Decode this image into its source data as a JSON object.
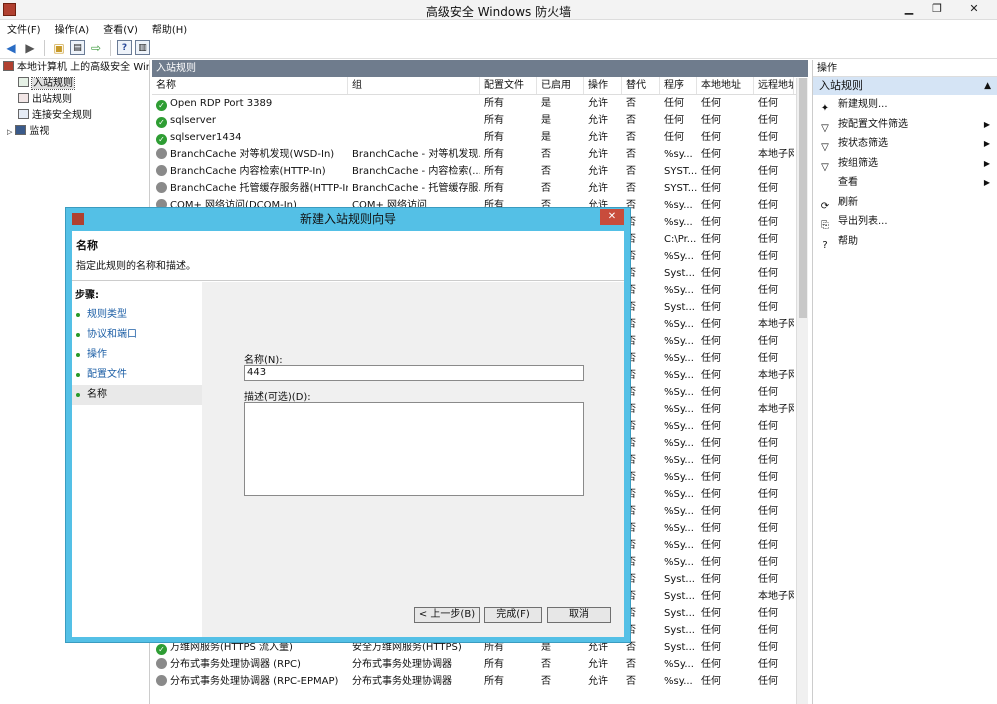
{
  "window": {
    "title": "高级安全 Windows 防火墙",
    "min": "▁",
    "max": "❐",
    "close": "✕"
  },
  "menu": [
    "文件(F)",
    "操作(A)",
    "查看(V)",
    "帮助(H)"
  ],
  "tree": [
    {
      "label": "本地计算机 上的高级安全 Windows 防火墙"
    },
    {
      "label": "入站规则"
    },
    {
      "label": "出站规则"
    },
    {
      "label": "连接安全规则"
    },
    {
      "label": "监视"
    }
  ],
  "pane": {
    "title": "入站规则"
  },
  "columns": [
    "名称",
    "组",
    "配置文件",
    "已启用",
    "操作",
    "替代",
    "程序",
    "本地地址",
    "远程地址"
  ],
  "rows": [
    [
      "Open RDP Port 3389",
      "",
      "所有",
      "是",
      "允许",
      "否",
      "任何",
      "任何",
      "任何"
    ],
    [
      "sqlserver",
      "",
      "所有",
      "是",
      "允许",
      "否",
      "任何",
      "任何",
      "任何"
    ],
    [
      "sqlserver1434",
      "",
      "所有",
      "是",
      "允许",
      "否",
      "任何",
      "任何",
      "任何"
    ],
    [
      "BranchCache 对等机发现(WSD-In)",
      "BranchCache - 对等机发现...",
      "所有",
      "否",
      "允许",
      "否",
      "%sy...",
      "任何",
      "本地子网"
    ],
    [
      "BranchCache 内容检索(HTTP-In)",
      "BranchCache - 内容检索(...",
      "所有",
      "否",
      "允许",
      "否",
      "SYST...",
      "任何",
      "任何"
    ],
    [
      "BranchCache 托管缓存服务器(HTTP-In)",
      "BranchCache - 托管缓存服...",
      "所有",
      "否",
      "允许",
      "否",
      "SYST...",
      "任何",
      "任何"
    ],
    [
      "COM+ 网络访问(DCOM-In)",
      "COM+ 网络访问",
      "所有",
      "否",
      "允许",
      "否",
      "%sy...",
      "任何",
      "任何"
    ],
    [
      "",
      "",
      "",
      "",
      "",
      "否",
      "%sy...",
      "任何",
      "任何"
    ],
    [
      "",
      "",
      "",
      "",
      "",
      "否",
      "C:\\Pr...",
      "任何",
      "任何"
    ],
    [
      "",
      "",
      "",
      "",
      "",
      "否",
      "%Sy...",
      "任何",
      "任何"
    ],
    [
      "",
      "",
      "",
      "",
      "",
      "否",
      "Syst...",
      "任何",
      "任何"
    ],
    [
      "",
      "",
      "",
      "",
      "",
      "否",
      "%Sy...",
      "任何",
      "任何"
    ],
    [
      "",
      "",
      "",
      "",
      "",
      "否",
      "Syst...",
      "任何",
      "任何"
    ],
    [
      "",
      "",
      "",
      "",
      "",
      "否",
      "%Sy...",
      "任何",
      "本地子网"
    ],
    [
      "",
      "",
      "",
      "",
      "",
      "否",
      "%Sy...",
      "任何",
      "任何"
    ],
    [
      "",
      "",
      "",
      "",
      "",
      "否",
      "%Sy...",
      "任何",
      "任何"
    ],
    [
      "",
      "",
      "",
      "",
      "",
      "否",
      "%Sy...",
      "任何",
      "本地子网"
    ],
    [
      "",
      "",
      "",
      "",
      "",
      "否",
      "%Sy...",
      "任何",
      "任何"
    ],
    [
      "",
      "",
      "",
      "",
      "",
      "否",
      "%Sy...",
      "任何",
      "本地子网"
    ],
    [
      "",
      "",
      "",
      "",
      "",
      "否",
      "%Sy...",
      "任何",
      "任何"
    ],
    [
      "",
      "",
      "",
      "",
      "",
      "否",
      "%Sy...",
      "任何",
      "任何"
    ],
    [
      "",
      "",
      "",
      "",
      "",
      "否",
      "%Sy...",
      "任何",
      "任何"
    ],
    [
      "",
      "",
      "",
      "",
      "",
      "否",
      "%Sy...",
      "任何",
      "任何"
    ],
    [
      "",
      "",
      "",
      "",
      "",
      "否",
      "%Sy...",
      "任何",
      "任何"
    ],
    [
      "",
      "",
      "",
      "",
      "",
      "否",
      "%Sy...",
      "任何",
      "任何"
    ],
    [
      "",
      "",
      "",
      "",
      "",
      "否",
      "%Sy...",
      "任何",
      "任何"
    ],
    [
      "",
      "",
      "",
      "",
      "",
      "否",
      "%Sy...",
      "任何",
      "任何"
    ],
    [
      "",
      "",
      "",
      "",
      "",
      "否",
      "%Sy...",
      "任何",
      "任何"
    ],
    [
      "",
      "",
      "",
      "",
      "",
      "否",
      "Syst...",
      "任何",
      "任何"
    ],
    [
      "",
      "",
      "",
      "",
      "",
      "否",
      "Syst...",
      "任何",
      "本地子网"
    ],
    [
      "",
      "",
      "",
      "",
      "",
      "否",
      "Syst...",
      "任何",
      "任何"
    ],
    [
      "安全套接字隧道协议(SSTP-In)",
      "安全套接字隧道协议",
      "所有",
      "否",
      "允许",
      "否",
      "Syst...",
      "任何",
      "任何"
    ],
    [
      "万维网服务(HTTPS 流入量)",
      "安全万维网服务(HTTPS)",
      "所有",
      "是",
      "允许",
      "否",
      "Syst...",
      "任何",
      "任何"
    ],
    [
      "分布式事务处理协调器 (RPC)",
      "分布式事务处理协调器",
      "所有",
      "否",
      "允许",
      "否",
      "%Sy...",
      "任何",
      "任何"
    ],
    [
      "分布式事务处理协调器 (RPC-EPMAP)",
      "分布式事务处理协调器",
      "所有",
      "否",
      "允许",
      "否",
      "%sy...",
      "任何",
      "任何"
    ]
  ],
  "actions": {
    "header": "操作",
    "section": "入站规则",
    "items": [
      {
        "label": "新建规则...",
        "icon": "✦",
        "sub": ""
      },
      {
        "label": "按配置文件筛选",
        "icon": "▽",
        "sub": "▶"
      },
      {
        "label": "按状态筛选",
        "icon": "▽",
        "sub": "▶"
      },
      {
        "label": "按组筛选",
        "icon": "▽",
        "sub": "▶"
      },
      {
        "label": "查看",
        "icon": "",
        "sub": "▶"
      },
      {
        "label": "刷新",
        "icon": "⟳",
        "sub": ""
      },
      {
        "label": "导出列表...",
        "icon": "⎘",
        "sub": ""
      },
      {
        "label": "帮助",
        "icon": "?",
        "sub": ""
      }
    ]
  },
  "dialog": {
    "title": "新建入站规则向导",
    "close": "✕",
    "header_title": "名称",
    "header_sub": "指定此规则的名称和描述。",
    "steps_title": "步骤:",
    "steps": [
      "规则类型",
      "协议和端口",
      "操作",
      "配置文件",
      "名称"
    ],
    "name_label": "名称(N):",
    "name_value": "443",
    "desc_label": "描述(可选)(D):",
    "desc_value": "",
    "back": "< 上一步(B)",
    "finish": "完成(F)",
    "cancel": "取消"
  },
  "colors": {
    "enabled": "#2e9d33",
    "disabled": "#8a8a8a",
    "dialog_frame": "#54c0e6",
    "pane_header": "#6f7c8d",
    "actions_section": "#d5e4f5"
  }
}
